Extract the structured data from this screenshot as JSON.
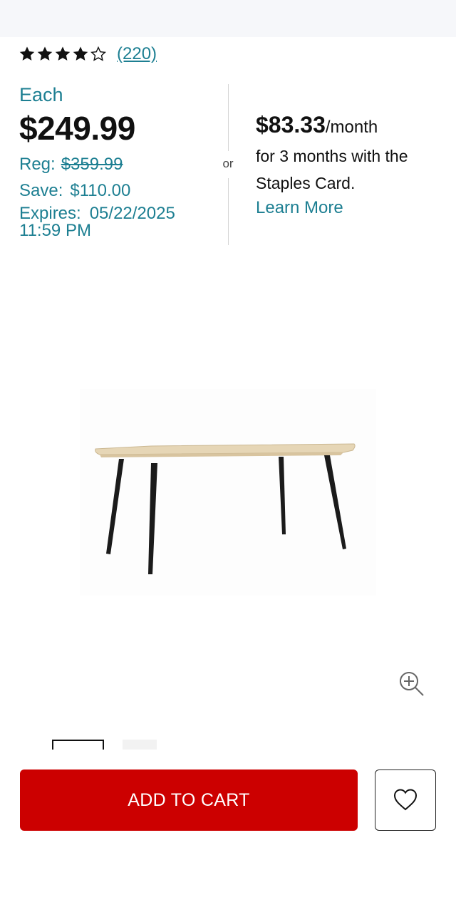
{
  "rating": {
    "stars_filled": 4,
    "stars_total": 5,
    "review_count": "(220)"
  },
  "price": {
    "each_label": "Each",
    "current": "$249.99",
    "reg_label": "Reg:",
    "reg_value": "$359.99",
    "save_label": "Save:",
    "save_value": "$110.00",
    "expires_label": "Expires:",
    "expires_date": "05/22/2025",
    "expires_time": "11:59 PM"
  },
  "separator": {
    "or_text": "or"
  },
  "financing": {
    "monthly_amount": "$83.33",
    "per_month": "/month",
    "line1": "for 3 months with the",
    "line2": "Staples Card.",
    "learn_more": "Learn More"
  },
  "icons": {
    "star": "star-icon",
    "zoom": "zoom-in-icon",
    "wishlist": "heart-icon"
  },
  "actions": {
    "add_to_cart": "ADD TO CART"
  },
  "colors": {
    "accent_teal": "#1d7f92",
    "cta_red": "#cc0000",
    "text_dark": "#111111"
  }
}
